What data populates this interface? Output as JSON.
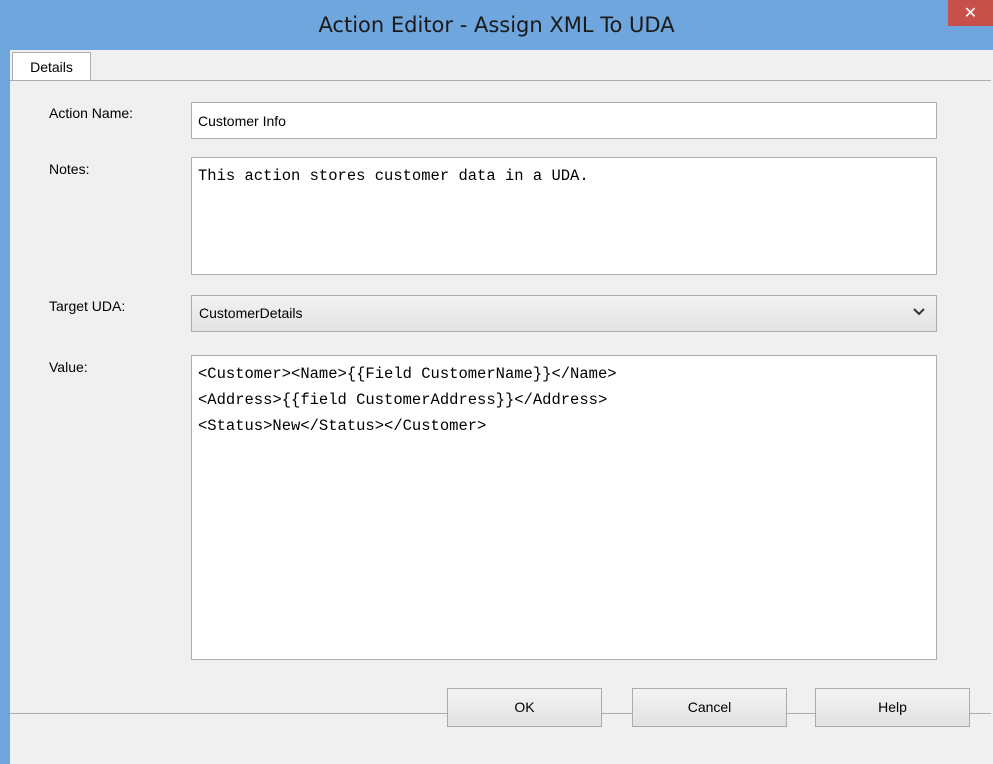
{
  "window": {
    "title": "Action Editor - Assign XML To UDA",
    "close_glyph": "✕"
  },
  "tabs": [
    {
      "label": "Details",
      "selected": true
    }
  ],
  "form": {
    "action_name": {
      "label": "Action Name:",
      "value": "Customer Info"
    },
    "notes": {
      "label": "Notes:",
      "value": "This action stores customer data in a UDA."
    },
    "target_uda": {
      "label": "Target UDA:",
      "value": "CustomerDetails",
      "icon": "chevron-down-icon"
    },
    "value": {
      "label": "Value:",
      "value": "<Customer><Name>{{Field CustomerName}}</Name>\n<Address>{{field CustomerAddress}}</Address>\n<Status>New</Status></Customer>"
    }
  },
  "buttons": {
    "ok": "OK",
    "cancel": "Cancel",
    "help": "Help"
  },
  "colors": {
    "titlebar": "#6ea6dd",
    "close": "#c7504a",
    "client": "#f0f0f0"
  }
}
